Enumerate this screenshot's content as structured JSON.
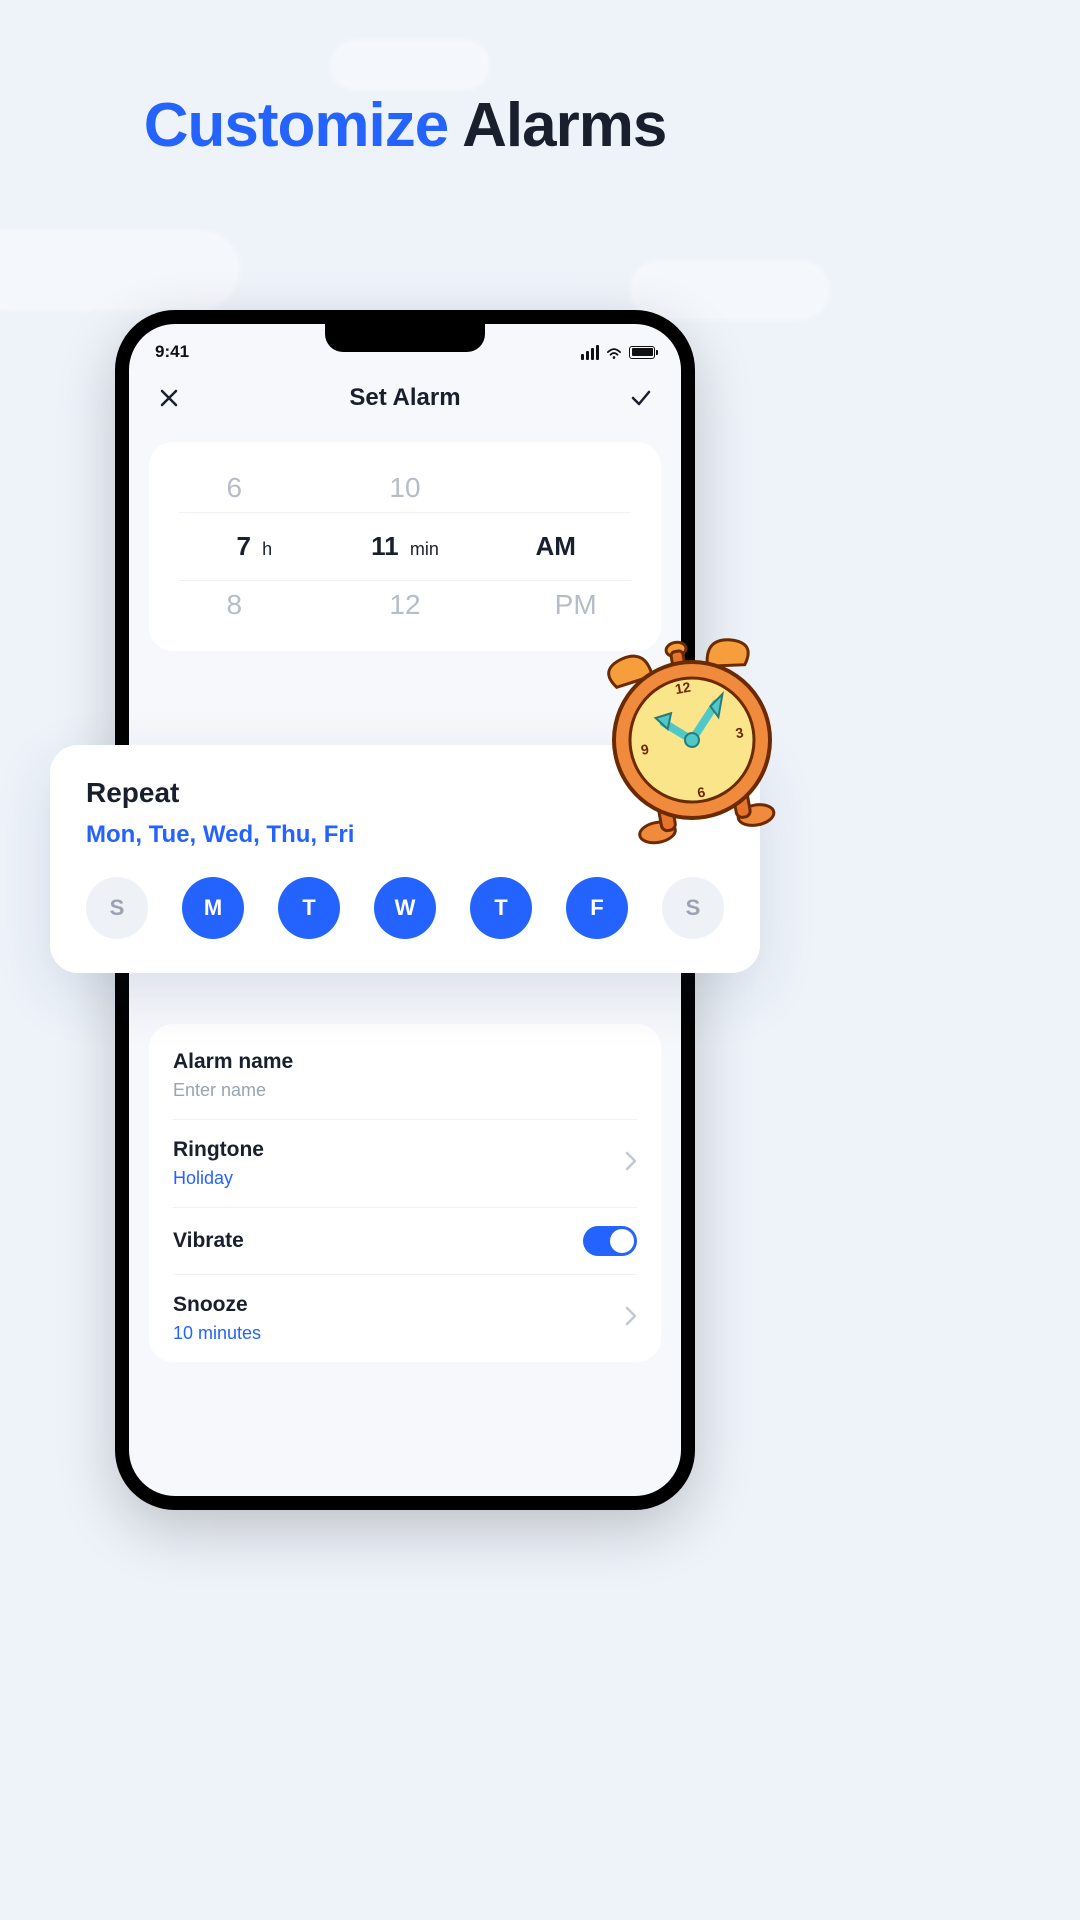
{
  "marketing": {
    "title_a": "Customize ",
    "title_b": "Alarms"
  },
  "status": {
    "time": "9:41"
  },
  "nav": {
    "title": "Set Alarm"
  },
  "picker": {
    "hour_prev": "6",
    "hour_sel": "7",
    "hour_unit": "h",
    "hour_next": "8",
    "min_prev": "10",
    "min_sel": "11",
    "min_unit": "min",
    "min_next": "12",
    "period_sel": "AM",
    "period_next": "PM"
  },
  "repeat": {
    "title": "Repeat",
    "summary": "Mon, Tue, Wed, Thu, Fri",
    "days": [
      {
        "label": "S",
        "on": false
      },
      {
        "label": "M",
        "on": true
      },
      {
        "label": "T",
        "on": true
      },
      {
        "label": "W",
        "on": true
      },
      {
        "label": "T",
        "on": true
      },
      {
        "label": "F",
        "on": true
      },
      {
        "label": "S",
        "on": false
      }
    ]
  },
  "settings": {
    "alarm_name_label": "Alarm name",
    "alarm_name_placeholder": "Enter name",
    "ringtone_label": "Ringtone",
    "ringtone_value": "Holiday",
    "vibrate_label": "Vibrate",
    "vibrate_on": true,
    "snooze_label": "Snooze",
    "snooze_value": "10 minutes"
  }
}
